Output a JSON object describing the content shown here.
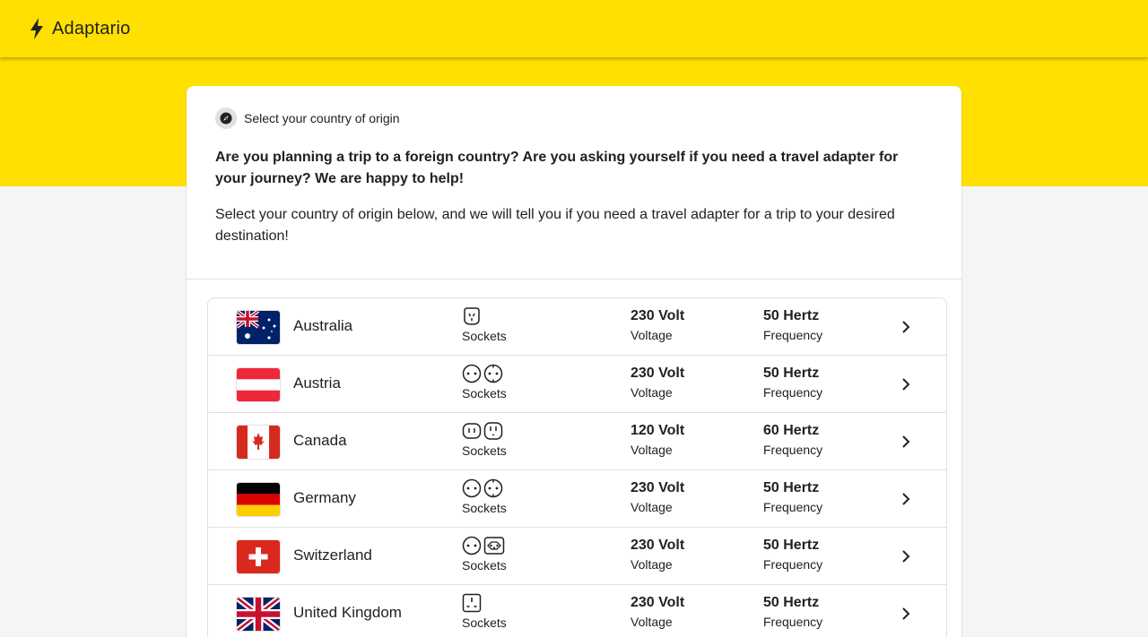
{
  "app": {
    "name": "Adaptario"
  },
  "card": {
    "subtitle": "Select your country of origin",
    "intro": "Are you planning a trip to a foreign country? Are you asking yourself if you need a travel adapter for your journey? We are happy to help!",
    "description": "Select your country of origin below, and we will tell you if you need a travel adapter for a trip to your desired destination!"
  },
  "labels": {
    "sockets": "Sockets",
    "voltage": "Voltage",
    "frequency": "Frequency"
  },
  "countries": [
    {
      "name": "Australia",
      "voltage": "230 Volt",
      "frequency": "50 Hertz",
      "flag": "australia-flag",
      "sockets": [
        "type-i-socket-icon"
      ]
    },
    {
      "name": "Austria",
      "voltage": "230 Volt",
      "frequency": "50 Hertz",
      "flag": "austria-flag",
      "sockets": [
        "type-c-socket-icon",
        "type-f-socket-icon"
      ]
    },
    {
      "name": "Canada",
      "voltage": "120 Volt",
      "frequency": "60 Hertz",
      "flag": "canada-flag",
      "sockets": [
        "type-a-socket-icon",
        "type-b-socket-icon"
      ]
    },
    {
      "name": "Germany",
      "voltage": "230 Volt",
      "frequency": "50 Hertz",
      "flag": "germany-flag",
      "sockets": [
        "type-c-socket-icon",
        "type-f-socket-icon"
      ]
    },
    {
      "name": "Switzerland",
      "voltage": "230 Volt",
      "frequency": "50 Hertz",
      "flag": "switzerland-flag",
      "sockets": [
        "type-c-socket-icon",
        "type-j-socket-icon"
      ]
    },
    {
      "name": "United Kingdom",
      "voltage": "230 Volt",
      "frequency": "50 Hertz",
      "flag": "united-kingdom-flag",
      "sockets": [
        "type-g-socket-icon"
      ]
    }
  ],
  "colors": {
    "brand_yellow": "#ffe000",
    "text": "#212121",
    "divider": "#e0e0e0"
  }
}
